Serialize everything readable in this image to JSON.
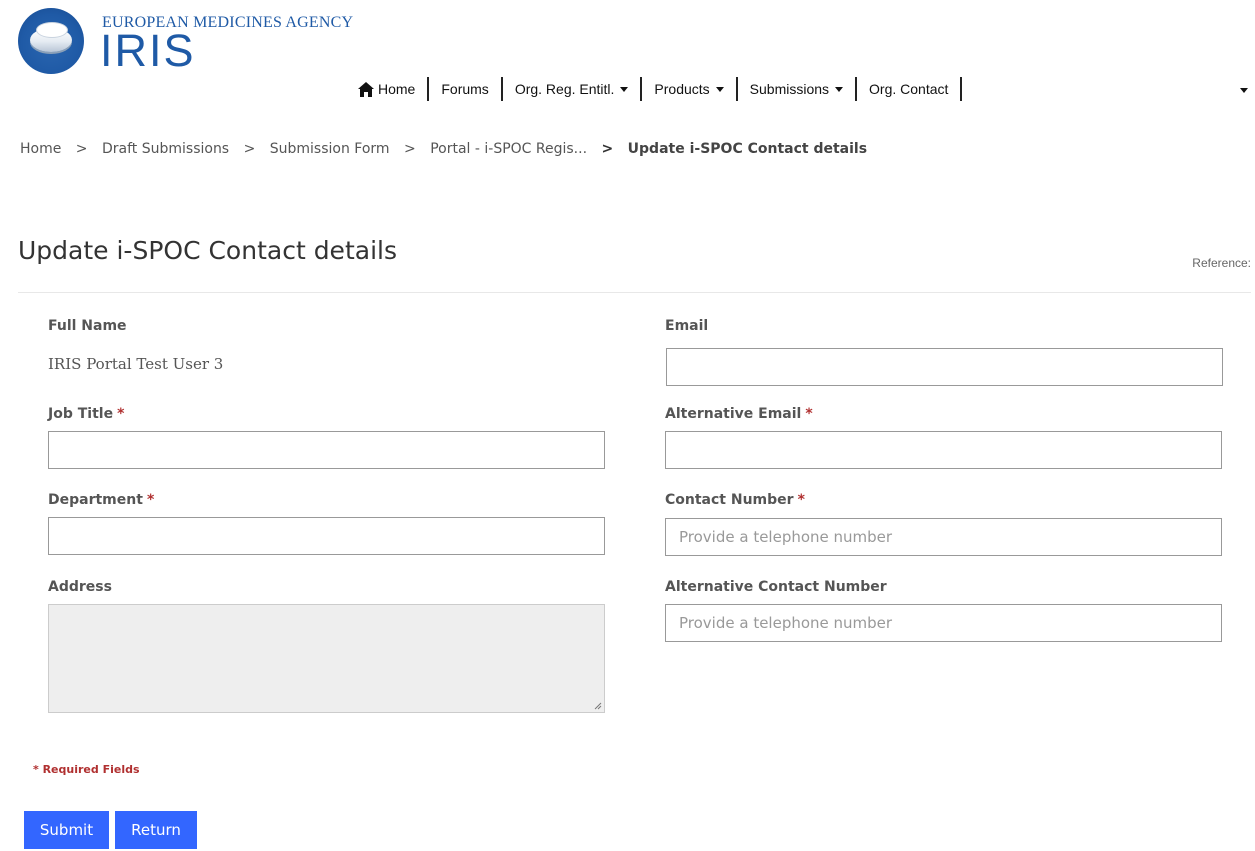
{
  "logo": {
    "agency_name": "EUROPEAN MEDICINES AGENCY",
    "product_name": "IRIS"
  },
  "nav": {
    "items": [
      {
        "label": "Home",
        "icon": "home-icon",
        "dropdown": false
      },
      {
        "label": "Forums",
        "dropdown": false
      },
      {
        "label": "Org. Reg. Entitl.",
        "dropdown": true
      },
      {
        "label": "Products",
        "dropdown": true
      },
      {
        "label": "Submissions",
        "dropdown": true
      },
      {
        "label": "Org. Contact",
        "dropdown": false
      }
    ]
  },
  "breadcrumb": {
    "items": [
      "Home",
      "Draft Submissions",
      "Submission Form",
      "Portal - i-SPOC Regis..."
    ],
    "current": "Update i-SPOC Contact details",
    "separator": ">"
  },
  "page": {
    "title": "Update i-SPOC Contact details",
    "reference_label": "Reference:"
  },
  "form": {
    "full_name": {
      "label": "Full Name",
      "value": "IRIS Portal Test User 3"
    },
    "email": {
      "label": "Email",
      "value": ""
    },
    "job_title": {
      "label": "Job Title",
      "required": "*",
      "value": ""
    },
    "alt_email": {
      "label": "Alternative Email",
      "required": "*",
      "value": ""
    },
    "department": {
      "label": "Department",
      "required": "*",
      "value": ""
    },
    "contact_number": {
      "label": "Contact Number",
      "required": "*",
      "placeholder": "Provide a telephone number"
    },
    "address": {
      "label": "Address",
      "value": ""
    },
    "alt_contact_number": {
      "label": "Alternative Contact Number",
      "placeholder": "Provide a telephone number"
    },
    "required_note": "* Required Fields"
  },
  "buttons": {
    "submit": "Submit",
    "return": "Return"
  },
  "colors": {
    "brand_blue": "#1f5aa6",
    "button_blue": "#3366ff",
    "required_red": "#b03030"
  }
}
